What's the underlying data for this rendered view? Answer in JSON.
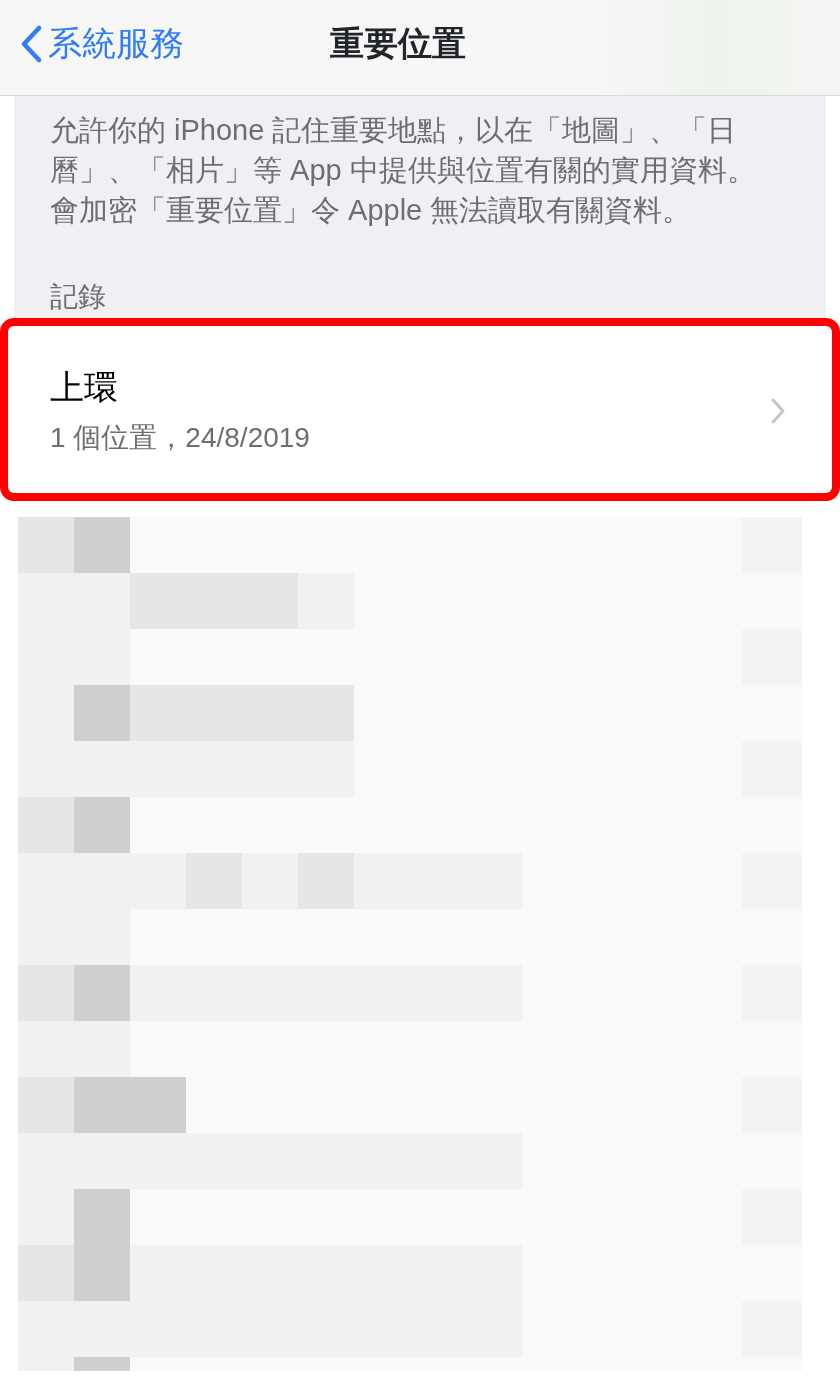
{
  "nav_bar": {
    "back_label": "系統服務",
    "title": "重要位置"
  },
  "description": "允許你的 iPhone 記住重要地點，以在「地圖」、「日曆」、「相片」等 App 中提供與位置有關的實用資料。會加密「重要位置」令 Apple 無法讀取有關資料。",
  "section_header": "記錄",
  "records": [
    {
      "title": "上環",
      "subtitle": "1 個位置，24/8/2019",
      "highlighted": true
    }
  ]
}
